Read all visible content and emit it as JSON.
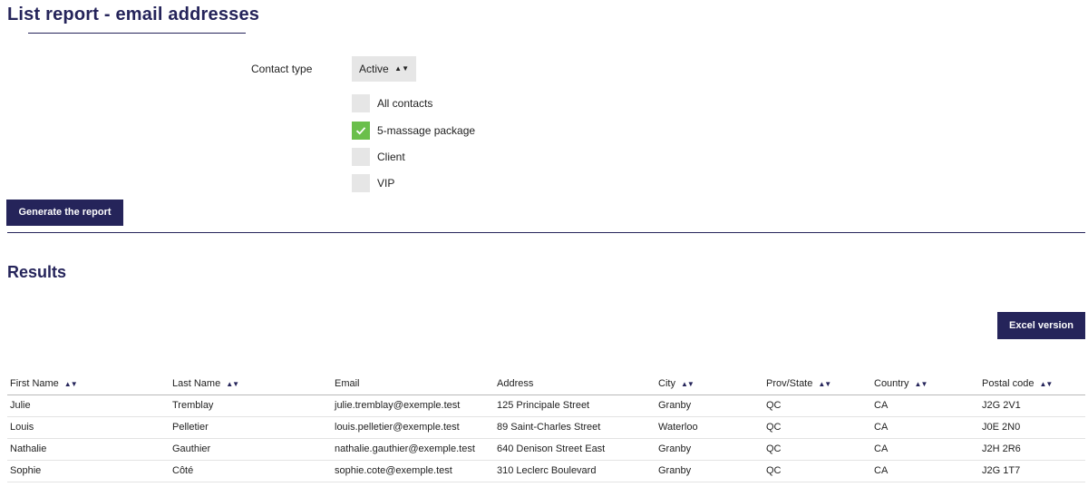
{
  "page": {
    "title": "List report - email addresses"
  },
  "filters": {
    "contact_type_label": "Contact type",
    "contact_type_value": "Active",
    "checkboxes": [
      {
        "label": "All contacts",
        "checked": false
      },
      {
        "label": "5-massage package",
        "checked": true
      },
      {
        "label": "Client",
        "checked": false
      },
      {
        "label": "VIP",
        "checked": false
      }
    ],
    "generate_label": "Generate the report"
  },
  "results": {
    "heading": "Results",
    "excel_label": "Excel version",
    "columns": [
      {
        "label": "First Name",
        "sortable": true
      },
      {
        "label": "Last Name",
        "sortable": true
      },
      {
        "label": "Email",
        "sortable": false
      },
      {
        "label": "Address",
        "sortable": false
      },
      {
        "label": "City",
        "sortable": true
      },
      {
        "label": "Prov/State",
        "sortable": true
      },
      {
        "label": "Country",
        "sortable": true
      },
      {
        "label": "Postal code",
        "sortable": true
      }
    ],
    "rows": [
      [
        "Julie",
        "Tremblay",
        "julie.tremblay@exemple.test",
        "125 Principale Street",
        "Granby",
        "QC",
        "CA",
        "J2G 2V1"
      ],
      [
        "Louis",
        "Pelletier",
        "louis.pelletier@exemple.test",
        "89 Saint-Charles Street",
        "Waterloo",
        "QC",
        "CA",
        "J0E 2N0"
      ],
      [
        "Nathalie",
        "Gauthier",
        "nathalie.gauthier@exemple.test",
        "640 Denison Street East",
        "Granby",
        "QC",
        "CA",
        "J2H 2R6"
      ],
      [
        "Sophie",
        "Côté",
        "sophie.cote@exemple.test",
        "310 Leclerc Boulevard",
        "Granby",
        "QC",
        "CA",
        "J2G 1T7"
      ]
    ]
  },
  "colors": {
    "primary": "#25245a",
    "checked": "#6abf4b",
    "field_bg": "#e6e6e6"
  },
  "icons": {
    "sort": "sort-up-down-icon",
    "select_arrows": "select-arrows-icon",
    "check": "check-icon"
  }
}
